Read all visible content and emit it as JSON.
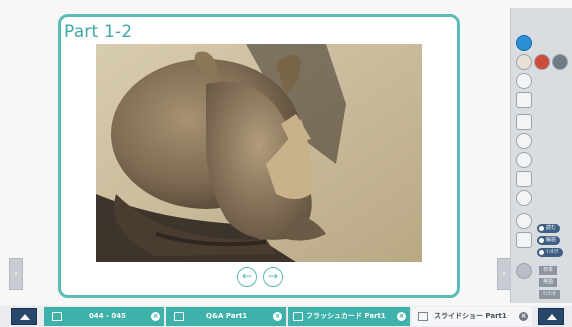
{
  "slide": {
    "title": "Part 1-2",
    "prev_icon": "arrow-left-icon",
    "next_icon": "arrow-right-icon",
    "prev_glyph": "←",
    "next_glyph": "→"
  },
  "side_tabs": {
    "left_glyph": "›",
    "right_glyph": "›"
  },
  "toolbar": {
    "buttons": [
      {
        "label": "読む"
      },
      {
        "label": "解説"
      },
      {
        "label": "ｲﾝﾀﾗｸ"
      }
    ],
    "grey_buttons": [
      {
        "label": "日本"
      },
      {
        "label": "英語"
      },
      {
        "label": "ﾘﾝﾂﾝﾀ"
      }
    ]
  },
  "tabs": [
    {
      "label": "044 - 045",
      "icon": "book-icon"
    },
    {
      "label": "Q&A Part1",
      "icon": "qa-icon"
    },
    {
      "label": "フラッシュカード Part1",
      "icon": "flashcard-icon"
    },
    {
      "label": "スライドショー Part1",
      "icon": "slideshow-icon"
    }
  ],
  "close_glyph": "×",
  "colors": {
    "accent": "#5bbbb7",
    "tab": "#3fb1ab",
    "nav": "#27476b"
  }
}
